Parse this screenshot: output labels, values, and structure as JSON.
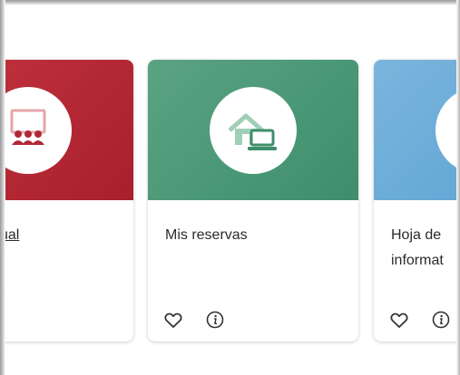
{
  "cards": [
    {
      "title": "ual",
      "hero_color": "#b02836",
      "icon": "group-presentation-icon"
    },
    {
      "title": "Mis reservas",
      "hero_color": "#4a9874",
      "icon": "home-laptop-icon",
      "actions": [
        "favorite-icon",
        "info-icon"
      ]
    },
    {
      "title_line1": "Hoja de",
      "title_line2": "informat",
      "hero_color": "#6aa9d8",
      "actions": [
        "favorite-icon",
        "info-icon"
      ]
    }
  ]
}
